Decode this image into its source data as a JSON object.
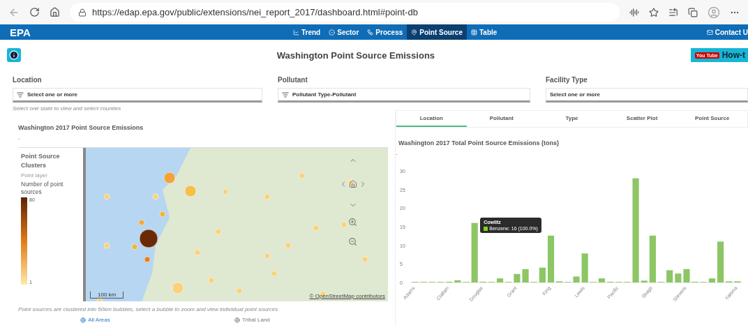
{
  "browser": {
    "url": "https://edap.epa.gov/public/extensions/nei_report_2017/dashboard.html#point-db"
  },
  "navbar": {
    "logo": "EPA",
    "items": [
      {
        "label": "Trend",
        "kind": "trend",
        "selected": false
      },
      {
        "label": "Sector",
        "kind": "sector",
        "selected": false
      },
      {
        "label": "Process",
        "kind": "process",
        "selected": false
      },
      {
        "label": "Point Source",
        "kind": "pin",
        "selected": true
      },
      {
        "label": "Table",
        "kind": "table",
        "selected": false
      }
    ],
    "contact": "Contact U"
  },
  "header": {
    "title": "Washington Point Source Emissions",
    "video_badge": "You Tube",
    "video_link": "How-t"
  },
  "filters": [
    {
      "label": "Location",
      "kind": "list",
      "value": "Select one or more",
      "hint": "Select one state to view and select counties"
    },
    {
      "label": "Pollutant",
      "kind": "list",
      "value": "Pollutant Type-Pollutant"
    },
    {
      "label": "Facility Type",
      "kind": "plain",
      "value": "Select one or more"
    }
  ],
  "map_panel": {
    "title": "Washington 2017 Point Source Emissions",
    "subtitle": "-",
    "legend": {
      "title": "Point Source Clusters",
      "layer": "Point layer",
      "measure": "Number of point sources",
      "max": "80",
      "min": "1"
    },
    "scale": "100 km",
    "attribution": "© OpenStreetMap contributors",
    "caption": "Point sources are clustered into 50km bubbles, select a bubble to zoom and view individual point sources",
    "area_options": [
      {
        "label": "All Areas",
        "selected": true
      },
      {
        "label": "Tribal Land",
        "selected": false
      }
    ]
  },
  "chart_panel": {
    "tabs": [
      {
        "label": "Location",
        "selected": true
      },
      {
        "label": "Pollutant",
        "selected": false
      },
      {
        "label": "Type",
        "selected": false
      },
      {
        "label": "Scatter Plot",
        "selected": false
      },
      {
        "label": "Point Source",
        "selected": false
      }
    ],
    "title": "Washington 2017 Total Point Source Emissions (tons)",
    "subtitle": "-",
    "chart_data": {
      "type": "bar",
      "categories": [
        "Adams",
        null,
        null,
        null,
        "Clallam",
        null,
        null,
        null,
        "Douglas",
        null,
        null,
        null,
        "Grant",
        null,
        null,
        null,
        "King",
        null,
        null,
        null,
        "Lewis",
        null,
        null,
        null,
        "Pacific",
        null,
        null,
        null,
        "Skagit",
        null,
        null,
        null,
        "Stevens",
        null,
        null,
        null,
        null,
        null,
        "Yakima"
      ],
      "series": [
        {
          "color": "#8cc665",
          "values": [
            0.1,
            0,
            0.1,
            0.1,
            0.2,
            0.6,
            0,
            16,
            0.2,
            0,
            1.1,
            0,
            2.3,
            3.6,
            0.1,
            4,
            12.6,
            0.3,
            0.1,
            1.6,
            7.8,
            0.1,
            1.1,
            0.2,
            0.1,
            0.1,
            28,
            0.5,
            12.6,
            0,
            3.3,
            2.4,
            3.6,
            0.2,
            0,
            1.1,
            11,
            0.3,
            0.3
          ]
        }
      ],
      "ylim": [
        0,
        30
      ],
      "yticks": [
        0,
        5,
        10,
        15,
        20,
        25,
        30
      ]
    },
    "tooltip": {
      "title": "Cowlitz",
      "item": "Benzene: 16 (100.0%)",
      "color": "#7ed321"
    }
  }
}
